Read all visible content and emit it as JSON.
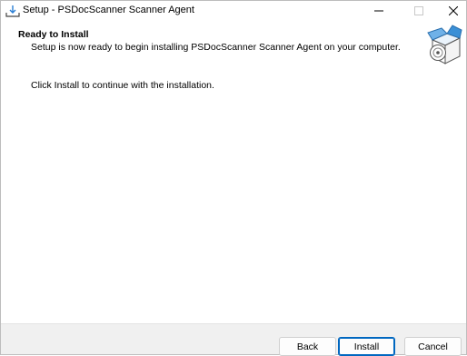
{
  "window": {
    "title": "Setup - PSDocScanner Scanner Agent"
  },
  "header": {
    "title": "Ready to Install",
    "subtitle": "Setup is now ready to begin installing PSDocScanner Scanner Agent on your computer."
  },
  "body": {
    "instruction": "Click Install to continue with the installation."
  },
  "buttons": {
    "back": "Back",
    "install": "Install",
    "cancel": "Cancel"
  },
  "colors": {
    "accent": "#0067c0",
    "footer_bg": "#f0f0f0",
    "graphic_blue": "#3a8fd6"
  },
  "icons": {
    "app": "setup-download-icon",
    "minimize": "minimize-icon",
    "maximize": "maximize-icon",
    "close": "close-icon",
    "header": "box-with-disc-icon"
  }
}
